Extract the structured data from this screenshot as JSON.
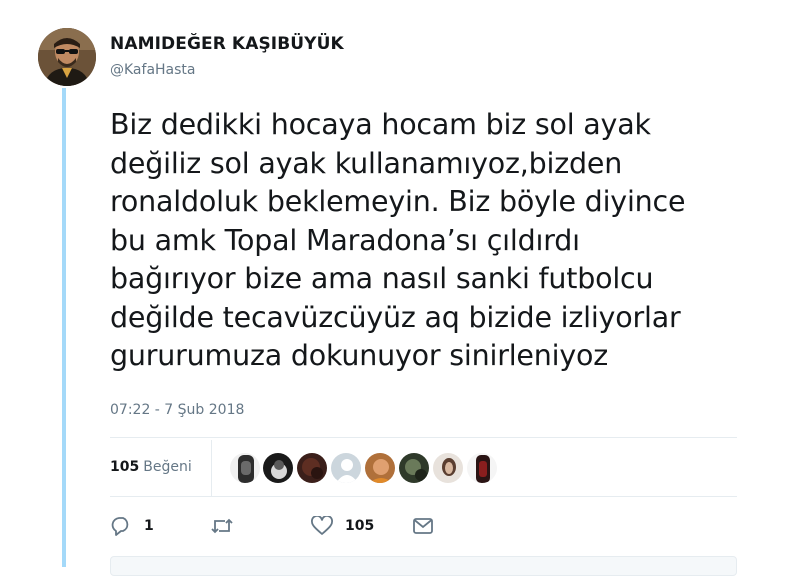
{
  "author": {
    "name": "NAMIDEĞER KAŞIBÜYÜK",
    "handle": "@KafaHasta"
  },
  "tweet": {
    "text": "Biz dedikki hocaya hocam biz sol ayak\ndeğiliz sol ayak kullanamıyoz,bizden\nronaldoluk beklemeyin. Biz böyle diyince\nbu amk Topal Maradona’sı çıldırdı\nbağırıyor bize ama nasıl sanki futbolcu\ndeğilde tecavüzcüyüz aq bizide izliyorlar\ngururumuza dokunuyor sinirleniyoz",
    "timestamp": "07:22 - 7 Şub 2018"
  },
  "stats": {
    "likes_number": "105",
    "likes_label": "Beğeni"
  },
  "actions": {
    "reply_count": "1",
    "like_count": "105"
  },
  "colors": {
    "thread_line": "#a4d9f9",
    "secondary_text": "#657786",
    "icon": "#657786",
    "divider": "#e6ecf0"
  },
  "icons": [
    "reply-icon",
    "retweet-icon",
    "heart-icon",
    "envelope-icon"
  ]
}
